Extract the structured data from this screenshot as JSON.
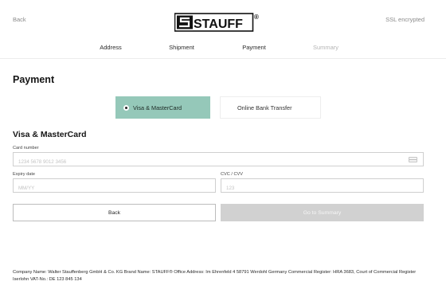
{
  "header": {
    "back_label": "Back",
    "logo_text": "STAUFF",
    "logo_mark": "®",
    "ssl_label": "SSL encrypted"
  },
  "steps": [
    {
      "label": "Address",
      "state": "done"
    },
    {
      "label": "Shipment",
      "state": "done"
    },
    {
      "label": "Payment",
      "state": "active"
    },
    {
      "label": "Summary",
      "state": "upcoming"
    }
  ],
  "page_title": "Payment",
  "payment_methods": [
    {
      "label": "Visa & MasterCard",
      "selected": true
    },
    {
      "label": "Online Bank Transfer",
      "selected": false
    }
  ],
  "card_form": {
    "title": "Visa & MasterCard",
    "card_number": {
      "label": "Card number",
      "placeholder": "1234 5678 9012 3456",
      "value": ""
    },
    "expiry": {
      "label": "Expiry date",
      "placeholder": "MM/YY",
      "value": ""
    },
    "cvc": {
      "label": "CVC / CVV",
      "placeholder": "123",
      "value": ""
    }
  },
  "actions": {
    "back_label": "Back",
    "next_label": "Go to Summary",
    "next_enabled": false
  },
  "footer": {
    "text": "Company Name: Walter Stauffenberg GmbH & Co. KG Brand Name: STAUFF® Office Address: Im Ehrenfeld 4 58791 Werdohl Germany Commercial Register: HRA 3683, Court of Commercial Register Iserlohn VAT-No.: DE 123 845 134"
  },
  "colors": {
    "selected_option": "#95c8b9",
    "disabled_button": "#d1d1d1",
    "muted_text": "#8a8a8a"
  },
  "icons": {
    "card_field_icon": "credit-card-icon",
    "logo_icon": "stauff-logo-icon"
  }
}
